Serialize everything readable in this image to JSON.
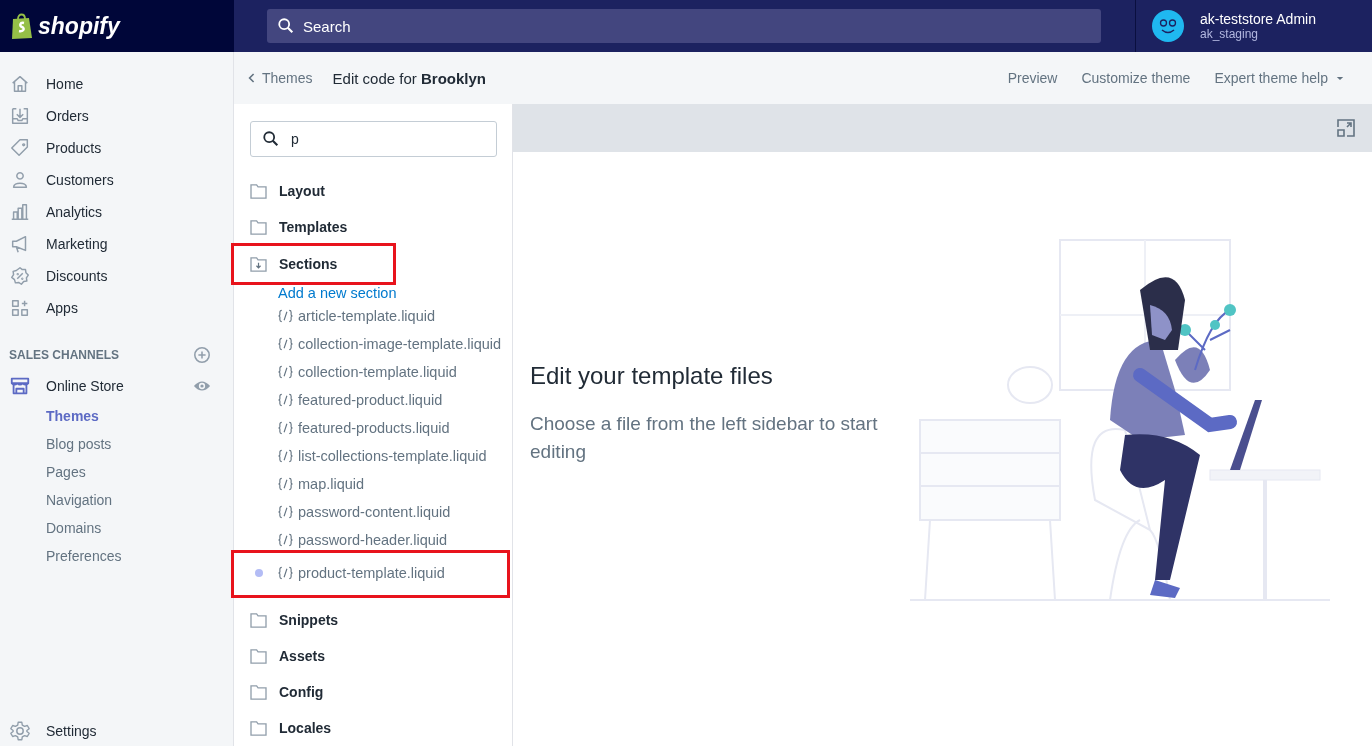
{
  "topbar": {
    "logo": "shopify",
    "search": {
      "placeholder": "Search"
    },
    "user": {
      "name": "ak-teststore Admin",
      "store": "ak_staging"
    }
  },
  "sidebar": {
    "items": [
      {
        "label": "Home"
      },
      {
        "label": "Orders"
      },
      {
        "label": "Products"
      },
      {
        "label": "Customers"
      },
      {
        "label": "Analytics"
      },
      {
        "label": "Marketing"
      },
      {
        "label": "Discounts"
      },
      {
        "label": "Apps"
      }
    ],
    "sales_channels": {
      "heading": "SALES CHANNELS",
      "channel": "Online Store",
      "children": [
        {
          "label": "Themes",
          "selected": true
        },
        {
          "label": "Blog posts",
          "selected": false
        },
        {
          "label": "Pages",
          "selected": false
        },
        {
          "label": "Navigation",
          "selected": false
        },
        {
          "label": "Domains",
          "selected": false
        },
        {
          "label": "Preferences",
          "selected": false
        }
      ]
    },
    "settings": "Settings"
  },
  "header": {
    "back": "Themes",
    "title": "Edit code for **Brooklyn**",
    "actions": [
      "Preview",
      "Customize theme",
      "Expert theme help"
    ]
  },
  "file_search": {
    "value": "p"
  },
  "folders": [
    {
      "label": "Layout",
      "expanded": false,
      "highlighted": false
    },
    {
      "label": "Templates",
      "expanded": false,
      "highlighted": false
    },
    {
      "label": "Sections",
      "expanded": true,
      "highlighted": true,
      "add_link": "Add a new section",
      "files": [
        {
          "name": "article-template.liquid",
          "active": false,
          "highlighted": false
        },
        {
          "name": "collection-image-template.liquid",
          "active": false,
          "highlighted": false
        },
        {
          "name": "collection-template.liquid",
          "active": false,
          "highlighted": false
        },
        {
          "name": "featured-product.liquid",
          "active": false,
          "highlighted": false
        },
        {
          "name": "featured-products.liquid",
          "active": false,
          "highlighted": false
        },
        {
          "name": "list-collections-template.liquid",
          "active": false,
          "highlighted": false
        },
        {
          "name": "map.liquid",
          "active": false,
          "highlighted": false
        },
        {
          "name": "password-content.liquid",
          "active": false,
          "highlighted": false
        },
        {
          "name": "password-header.liquid",
          "active": false,
          "highlighted": false
        },
        {
          "name": "product-template.liquid",
          "active": true,
          "highlighted": true
        }
      ]
    },
    {
      "label": "Snippets",
      "expanded": false,
      "highlighted": false
    },
    {
      "label": "Assets",
      "expanded": false,
      "highlighted": false
    },
    {
      "label": "Config",
      "expanded": false,
      "highlighted": false
    },
    {
      "label": "Locales",
      "expanded": false,
      "highlighted": false
    }
  ],
  "editor": {
    "heading": "Edit your template files",
    "text": "Choose a file from the left sidebar to start editing"
  }
}
